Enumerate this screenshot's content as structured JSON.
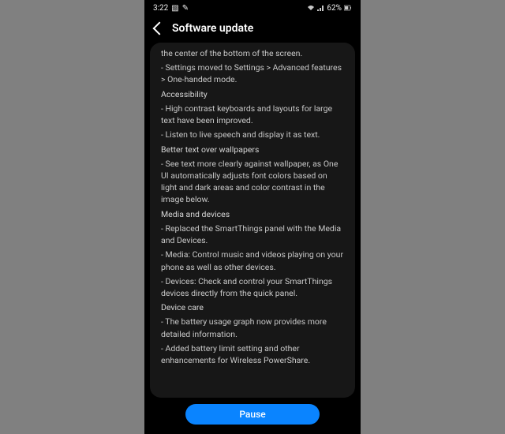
{
  "statusbar": {
    "time": "3:22",
    "battery_text": "62%",
    "icons": [
      "image",
      "edit"
    ],
    "right_icons": [
      "wifi",
      "signal",
      "battery"
    ]
  },
  "header": {
    "title": "Software update"
  },
  "notes": {
    "intro": [
      "the center of the bottom of the screen.",
      "- Settings moved to Settings > Advanced features > One-handed mode."
    ],
    "sections": [
      {
        "title": "Accessibility",
        "lines": [
          "- High contrast keyboards and layouts for large text have been improved.",
          "- Listen to live speech and display it as text."
        ]
      },
      {
        "title": "Better text over wallpapers",
        "lines": [
          "- See text more clearly against wallpaper, as One UI automatically adjusts font colors based on light and dark areas and color contrast in the image below."
        ]
      },
      {
        "title": "Media and devices",
        "lines": [
          "- Replaced the SmartThings panel with the Media and Devices.",
          "- Media: Control music and videos playing on your phone as well as other devices.",
          "- Devices: Check and control your SmartThings devices directly from the quick panel."
        ]
      },
      {
        "title": "Device care",
        "lines": [
          "- The battery usage graph now provides more detailed information.",
          "- Added battery limit setting and other enhancements for Wireless PowerShare."
        ]
      }
    ]
  },
  "footer": {
    "pause_label": "Pause"
  }
}
